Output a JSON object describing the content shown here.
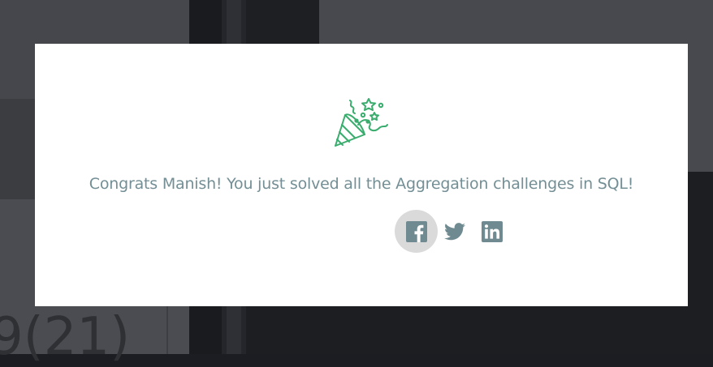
{
  "background": {
    "code_fragment": "9(21)"
  },
  "modal": {
    "icon": "party-popper-icon",
    "message": "Congrats Manish! You just solved all the Aggregation challenges in SQL!",
    "share": [
      {
        "icon": "facebook-icon",
        "highlighted": true
      },
      {
        "icon": "twitter-icon",
        "highlighted": false
      },
      {
        "icon": "linkedin-icon",
        "highlighted": false
      }
    ]
  },
  "colors": {
    "accent_green": "#3aad6e",
    "text_muted": "#738f95",
    "icon_gray": "#6f8a90",
    "hover_bg": "#dadada"
  }
}
